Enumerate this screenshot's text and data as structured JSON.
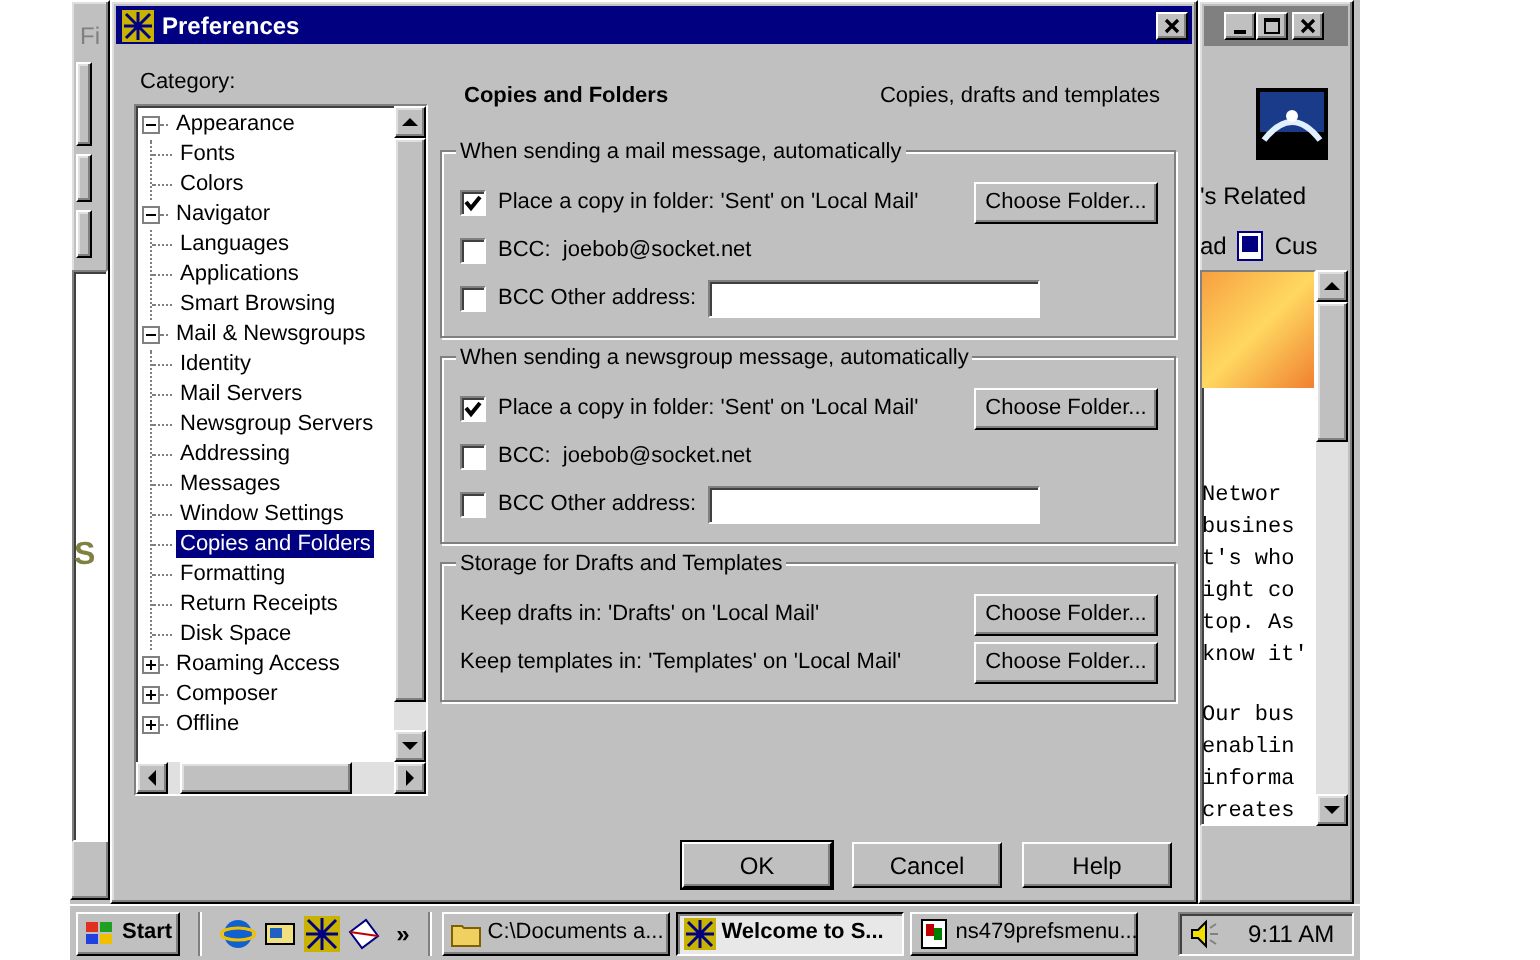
{
  "left_window": {
    "menu_fragment": "Fi",
    "page_fragment": "S"
  },
  "dialog": {
    "title": "Preferences",
    "category_label": "Category:",
    "tree": [
      {
        "label": "Appearance",
        "selected": false,
        "expanded": true,
        "children": [
          {
            "label": "Fonts",
            "selected": false
          },
          {
            "label": "Colors",
            "selected": false
          }
        ]
      },
      {
        "label": "Navigator",
        "selected": false,
        "expanded": true,
        "children": [
          {
            "label": "Languages",
            "selected": false
          },
          {
            "label": "Applications",
            "selected": false
          },
          {
            "label": "Smart Browsing",
            "selected": false
          }
        ]
      },
      {
        "label": "Mail & Newsgroups",
        "selected": false,
        "expanded": true,
        "children": [
          {
            "label": "Identity",
            "selected": false
          },
          {
            "label": "Mail Servers",
            "selected": false
          },
          {
            "label": "Newsgroup Servers",
            "selected": false
          },
          {
            "label": "Addressing",
            "selected": false
          },
          {
            "label": "Messages",
            "selected": false
          },
          {
            "label": "Window Settings",
            "selected": false
          },
          {
            "label": "Copies and Folders",
            "selected": true
          },
          {
            "label": "Formatting",
            "selected": false
          },
          {
            "label": "Return Receipts",
            "selected": false
          },
          {
            "label": "Disk Space",
            "selected": false
          }
        ]
      },
      {
        "label": "Roaming Access",
        "selected": false
      },
      {
        "label": "Composer",
        "selected": false
      },
      {
        "label": "Offline",
        "selected": false
      }
    ],
    "panel": {
      "title": "Copies and Folders",
      "subtitle": "Copies, drafts and templates",
      "groups": [
        {
          "legend": "When sending a mail message, automatically",
          "rows": [
            {
              "kind": "checkbox",
              "label": "Place a copy in folder: 'Sent' on 'Local Mail'",
              "checked": true,
              "button": "Choose Folder..."
            },
            {
              "kind": "checkbox",
              "label": "BCC:  joebob@socket.net",
              "checked": false
            },
            {
              "kind": "checkbox-field",
              "label": "BCC Other address:",
              "checked": false
            }
          ]
        },
        {
          "legend": "When sending a newsgroup message, automatically",
          "rows": [
            {
              "kind": "checkbox",
              "label": "Place a copy in folder: 'Sent' on 'Local Mail'",
              "checked": true,
              "button": "Choose Folder..."
            },
            {
              "kind": "checkbox",
              "label": "BCC:  joebob@socket.net",
              "checked": false
            },
            {
              "kind": "checkbox-field",
              "label": "BCC Other address:",
              "checked": false
            }
          ]
        },
        {
          "legend": "Storage for Drafts and Templates",
          "rows": [
            {
              "kind": "text",
              "label": "Keep drafts in: 'Drafts' on 'Local Mail'",
              "button": "Choose Folder..."
            },
            {
              "kind": "text",
              "label": "Keep templates in: 'Templates' on 'Local Mail'",
              "button": "Choose Folder..."
            }
          ]
        }
      ]
    },
    "buttons": [
      "OK",
      "Cancel",
      "Help"
    ]
  },
  "right_window": {
    "toolbar_fragment": "'s Related",
    "bookmarks": [
      "ad",
      "Cus"
    ],
    "paragraphs": [
      [
        "Networ",
        "busines",
        "t's who",
        "ight co",
        "top. As",
        "know it'"
      ],
      [
        "Our bus",
        "enablin",
        "informa",
        "creates"
      ]
    ]
  },
  "taskbar": {
    "start": "Start",
    "more": "»",
    "tasks": [
      {
        "label": "C:\\Documents a...",
        "selected": false
      },
      {
        "label": "Welcome to S...",
        "selected": true
      },
      {
        "label": "ns479prefsmenu...",
        "selected": false
      }
    ],
    "clock": "9:11 AM"
  }
}
